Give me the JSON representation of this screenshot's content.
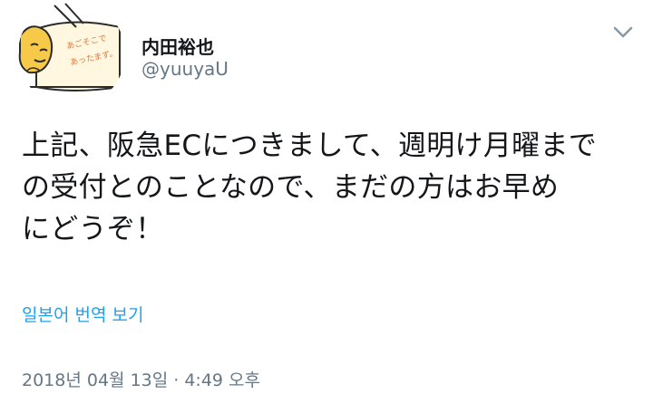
{
  "tweet": {
    "author": {
      "display_name": "内田裕也",
      "handle": "@yuuyaU",
      "avatar_icon": "avatar-gudetama-icon",
      "avatar_caption": "あごそこで あったまず。"
    },
    "text": "上記、阪急ECにつきまして、週明け月曜まで の受付とのことなので、まだの方はお早め にどうぞ！",
    "translate_label": "일본어 번역 보기",
    "timestamp": "2018년 04월 13일 · 4:49 오후",
    "menu_icon": "chevron-down-icon"
  },
  "colors": {
    "link": "#1da1f2",
    "muted": "#657786",
    "text": "#14171a",
    "avatar_yellow": "#f7c948"
  }
}
